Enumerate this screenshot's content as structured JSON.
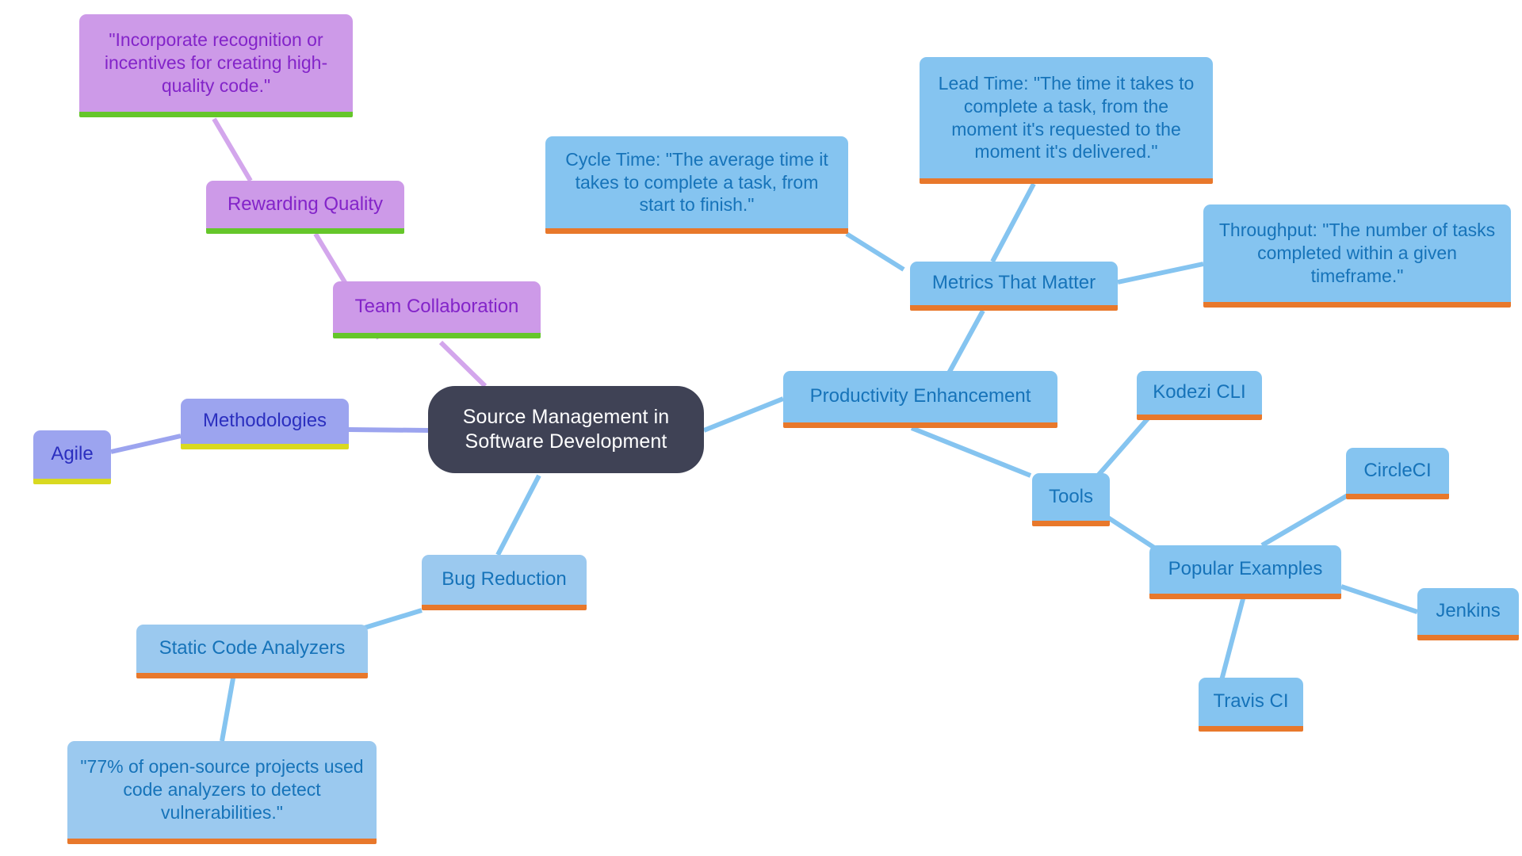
{
  "diagram": {
    "title": "Source Management in Software Development",
    "type": "mind-map",
    "background": "#ffffff",
    "palette": {
      "root_fill": "#3f4255",
      "root_text": "#ffffff",
      "purple_fill": "#cd9ae8",
      "purple_text": "#8324c9",
      "purple_underline": "#65c62a",
      "periwinkle_fill": "#9ca4ef",
      "periwinkle_text": "#2b2fbf",
      "periwinkle_underline": "#d9d920",
      "blue_fill": "#85c4f0",
      "blue_text": "#1673b9",
      "blue_underline": "#e8782b",
      "edge_purple": "#d3a6ec",
      "edge_periwinkle": "#9ca4ef",
      "edge_blue": "#85c4f0"
    }
  },
  "nodes": {
    "root": "Source Management in Software Development",
    "rewarding_quote": "\"Incorporate recognition or incentives for creating high-quality code.\"",
    "rewarding_quality": "Rewarding Quality",
    "team_collaboration": "Team Collaboration",
    "methodologies": "Methodologies",
    "agile": "Agile",
    "cycle_time": "Cycle Time: \"The average time it takes to complete a task, from start to finish.\"",
    "lead_time": "Lead Time: \"The time it takes to complete a task, from the moment it's requested to the moment it's delivered.\"",
    "metrics_that_matter": "Metrics That Matter",
    "throughput": "Throughput: \"The number of tasks completed within a given timeframe.\"",
    "productivity_enhancement": "Productivity Enhancement",
    "kodezi_cli": "Kodezi CLI",
    "tools": "Tools",
    "popular_examples": "Popular Examples",
    "circleci": "CircleCI",
    "jenkins": "Jenkins",
    "travis_ci": "Travis CI",
    "bug_reduction": "Bug Reduction",
    "static_code_analyzers": "Static Code Analyzers",
    "analyzers_quote": "\"77% of open-source projects used code analyzers to detect vulnerabilities.\""
  },
  "edges": [
    {
      "from": "root",
      "to": "team_collaboration",
      "color": "#d3a6ec"
    },
    {
      "from": "team_collaboration",
      "to": "rewarding_quality",
      "color": "#d3a6ec"
    },
    {
      "from": "rewarding_quality",
      "to": "rewarding_quote",
      "color": "#d3a6ec"
    },
    {
      "from": "root",
      "to": "methodologies",
      "color": "#9ca4ef"
    },
    {
      "from": "methodologies",
      "to": "agile",
      "color": "#9ca4ef"
    },
    {
      "from": "root",
      "to": "productivity_enhancement",
      "color": "#85c4f0"
    },
    {
      "from": "productivity_enhancement",
      "to": "metrics_that_matter",
      "color": "#85c4f0"
    },
    {
      "from": "metrics_that_matter",
      "to": "cycle_time",
      "color": "#85c4f0"
    },
    {
      "from": "metrics_that_matter",
      "to": "lead_time",
      "color": "#85c4f0"
    },
    {
      "from": "metrics_that_matter",
      "to": "throughput",
      "color": "#85c4f0"
    },
    {
      "from": "productivity_enhancement",
      "to": "tools",
      "color": "#85c4f0"
    },
    {
      "from": "tools",
      "to": "kodezi_cli",
      "color": "#85c4f0"
    },
    {
      "from": "tools",
      "to": "popular_examples",
      "color": "#85c4f0"
    },
    {
      "from": "popular_examples",
      "to": "circleci",
      "color": "#85c4f0"
    },
    {
      "from": "popular_examples",
      "to": "jenkins",
      "color": "#85c4f0"
    },
    {
      "from": "popular_examples",
      "to": "travis_ci",
      "color": "#85c4f0"
    },
    {
      "from": "root",
      "to": "bug_reduction",
      "color": "#85c4f0"
    },
    {
      "from": "bug_reduction",
      "to": "static_code_analyzers",
      "color": "#85c4f0"
    },
    {
      "from": "static_code_analyzers",
      "to": "analyzers_quote",
      "color": "#85c4f0"
    }
  ]
}
